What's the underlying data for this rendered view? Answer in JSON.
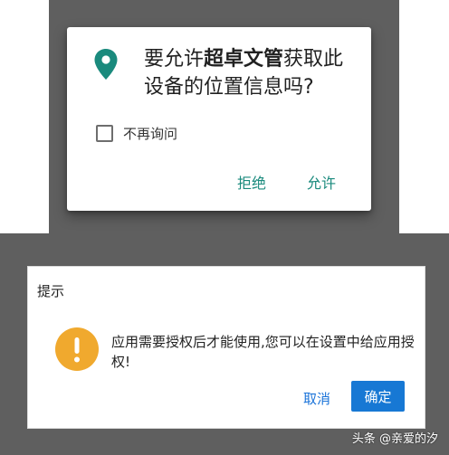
{
  "permission_dialog": {
    "message_prefix": "要允许",
    "app_name": "超卓文管",
    "message_suffix": "获取此设备的位置信息吗?",
    "dont_ask_label": "不再询问",
    "dont_ask_checked": false,
    "deny_label": "拒绝",
    "allow_label": "允许",
    "accent_color": "#1a8a7d",
    "icon": "location-pin-icon"
  },
  "tip_dialog": {
    "title": "提示",
    "message": "应用需要授权后才能使用,您可以在设置中给应用授权!",
    "cancel_label": "取消",
    "confirm_label": "确定",
    "icon": "warning-icon",
    "icon_color": "#f0a92e",
    "confirm_color": "#1778d4"
  },
  "watermark": "头条 @亲爱的汐"
}
